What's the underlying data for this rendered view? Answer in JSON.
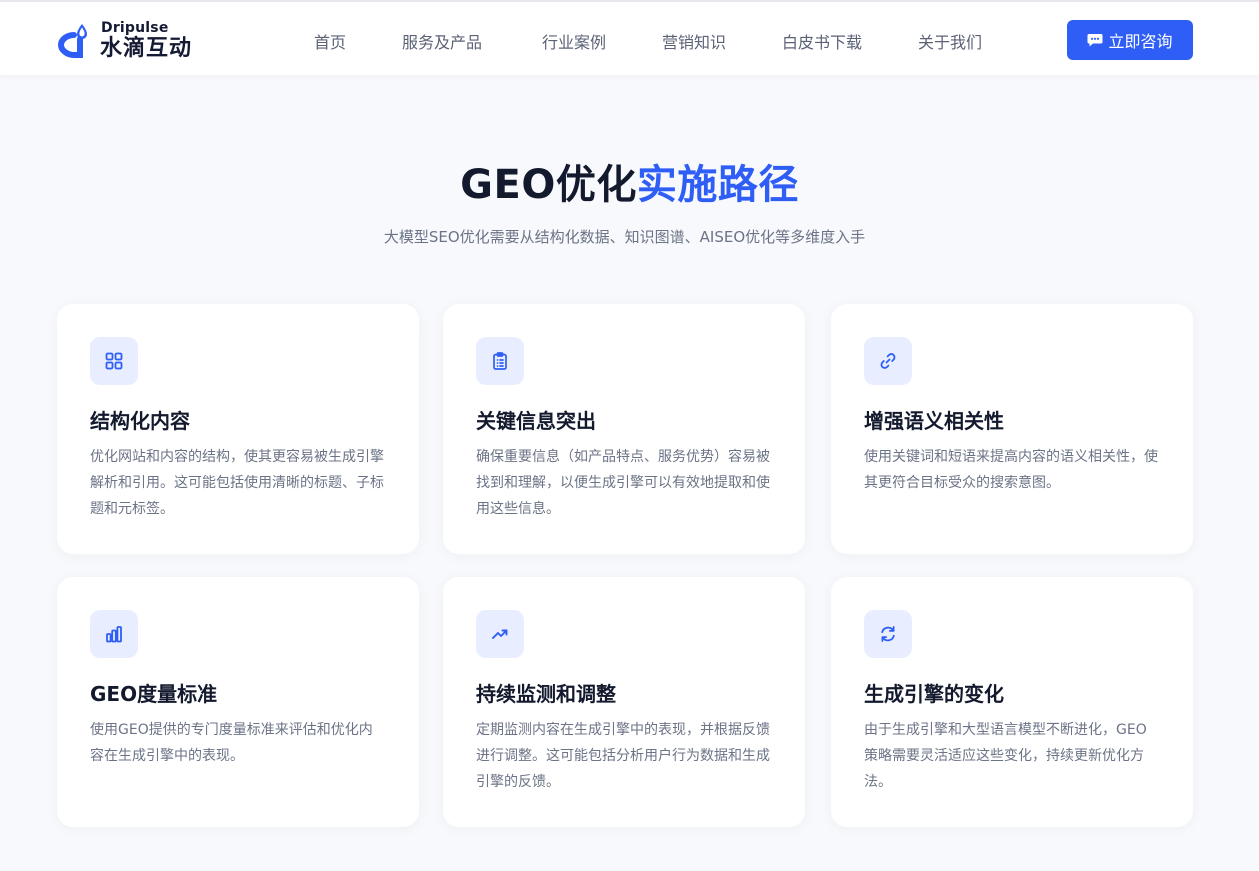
{
  "header": {
    "logo": {
      "en": "Dripulse",
      "cn": "水滴互动"
    },
    "nav": [
      {
        "label": "首页"
      },
      {
        "label": "服务及产品"
      },
      {
        "label": "行业案例"
      },
      {
        "label": "营销知识"
      },
      {
        "label": "白皮书下载"
      },
      {
        "label": "关于我们"
      }
    ],
    "cta_label": "立即咨询",
    "cta_icon": "chat-bubble-icon"
  },
  "section": {
    "title_main": "GEO优化",
    "title_accent": "实施路径",
    "subtitle": "大模型SEO优化需要从结构化数据、知识图谱、AISEO优化等多维度入手"
  },
  "cards": [
    {
      "icon": "grid-icon",
      "title": "结构化内容",
      "desc": "优化网站和内容的结构，使其更容易被生成引擎解析和引用。这可能包括使用清晰的标题、子标题和元标签。"
    },
    {
      "icon": "clipboard-list-icon",
      "title": "关键信息突出",
      "desc": "确保重要信息（如产品特点、服务优势）容易被找到和理解，以便生成引擎可以有效地提取和使用这些信息。"
    },
    {
      "icon": "link-icon",
      "title": "增强语义相关性",
      "desc": "使用关键词和短语来提高内容的语义相关性，使其更符合目标受众的搜索意图。"
    },
    {
      "icon": "bar-chart-icon",
      "title": "GEO度量标准",
      "desc": "使用GEO提供的专门度量标准来评估和优化内容在生成引擎中的表现。"
    },
    {
      "icon": "trending-up-icon",
      "title": "持续监测和调整",
      "desc": "定期监测内容在生成引擎中的表现，并根据反馈进行调整。这可能包括分析用户行为数据和生成引擎的反馈。"
    },
    {
      "icon": "refresh-icon",
      "title": "生成引擎的变化",
      "desc": "由于生成引擎和大型语言模型不断进化，GEO策略需要灵活适应这些变化，持续更新优化方法。"
    }
  ],
  "colors": {
    "accent": "#2f5ef6",
    "icon_bg": "#e8eeff",
    "text_dark": "#131a2e",
    "text_muted": "#6b7386"
  }
}
